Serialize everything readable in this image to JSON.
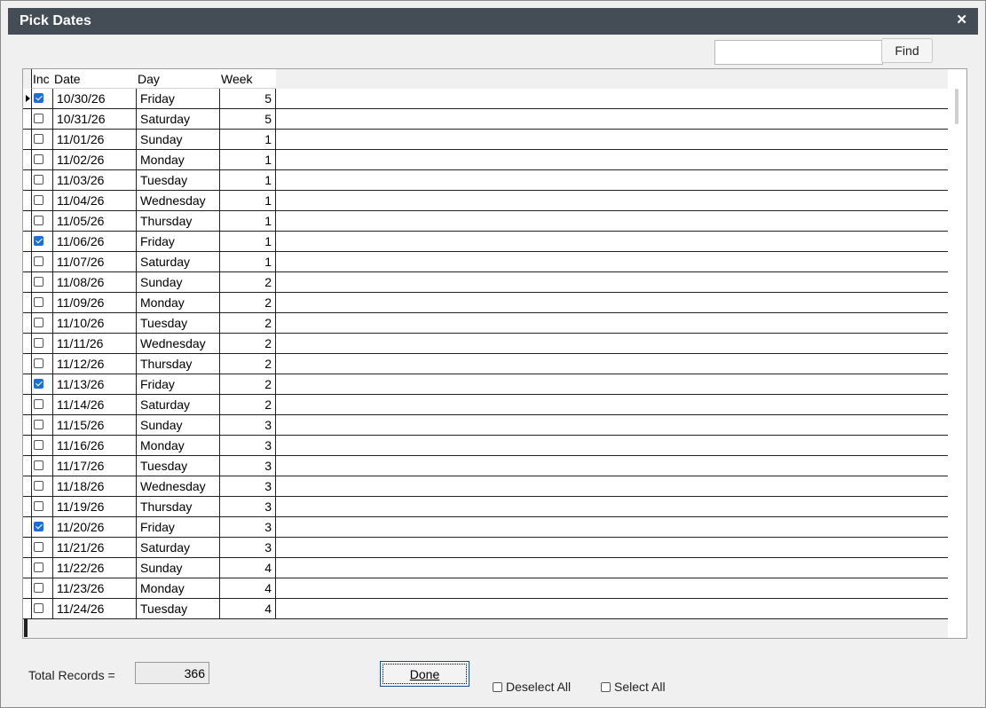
{
  "window": {
    "title": "Pick Dates",
    "close_glyph": "✕"
  },
  "search": {
    "value": "",
    "placeholder": "",
    "find_label": "Find"
  },
  "grid": {
    "columns": [
      "Inc",
      "Date",
      "Day",
      "Week"
    ],
    "rows": [
      {
        "inc": true,
        "date": "10/30/26",
        "day": "Friday",
        "week": "5",
        "current": true
      },
      {
        "inc": false,
        "date": "10/31/26",
        "day": "Saturday",
        "week": "5"
      },
      {
        "inc": false,
        "date": "11/01/26",
        "day": "Sunday",
        "week": "1"
      },
      {
        "inc": false,
        "date": "11/02/26",
        "day": "Monday",
        "week": "1"
      },
      {
        "inc": false,
        "date": "11/03/26",
        "day": "Tuesday",
        "week": "1"
      },
      {
        "inc": false,
        "date": "11/04/26",
        "day": "Wednesday",
        "week": "1"
      },
      {
        "inc": false,
        "date": "11/05/26",
        "day": "Thursday",
        "week": "1"
      },
      {
        "inc": true,
        "date": "11/06/26",
        "day": "Friday",
        "week": "1"
      },
      {
        "inc": false,
        "date": "11/07/26",
        "day": "Saturday",
        "week": "1"
      },
      {
        "inc": false,
        "date": "11/08/26",
        "day": "Sunday",
        "week": "2"
      },
      {
        "inc": false,
        "date": "11/09/26",
        "day": "Monday",
        "week": "2"
      },
      {
        "inc": false,
        "date": "11/10/26",
        "day": "Tuesday",
        "week": "2"
      },
      {
        "inc": false,
        "date": "11/11/26",
        "day": "Wednesday",
        "week": "2"
      },
      {
        "inc": false,
        "date": "11/12/26",
        "day": "Thursday",
        "week": "2"
      },
      {
        "inc": true,
        "date": "11/13/26",
        "day": "Friday",
        "week": "2"
      },
      {
        "inc": false,
        "date": "11/14/26",
        "day": "Saturday",
        "week": "2"
      },
      {
        "inc": false,
        "date": "11/15/26",
        "day": "Sunday",
        "week": "3"
      },
      {
        "inc": false,
        "date": "11/16/26",
        "day": "Monday",
        "week": "3"
      },
      {
        "inc": false,
        "date": "11/17/26",
        "day": "Tuesday",
        "week": "3"
      },
      {
        "inc": false,
        "date": "11/18/26",
        "day": "Wednesday",
        "week": "3"
      },
      {
        "inc": false,
        "date": "11/19/26",
        "day": "Thursday",
        "week": "3"
      },
      {
        "inc": true,
        "date": "11/20/26",
        "day": "Friday",
        "week": "3"
      },
      {
        "inc": false,
        "date": "11/21/26",
        "day": "Saturday",
        "week": "3"
      },
      {
        "inc": false,
        "date": "11/22/26",
        "day": "Sunday",
        "week": "4"
      },
      {
        "inc": false,
        "date": "11/23/26",
        "day": "Monday",
        "week": "4"
      },
      {
        "inc": false,
        "date": "11/24/26",
        "day": "Tuesday",
        "week": "4"
      }
    ]
  },
  "footer": {
    "total_label": "Total Records =",
    "total_value": "366",
    "done_label": "Done",
    "deselect_all_label": "Deselect All",
    "select_all_label": "Select All"
  },
  "colors": {
    "titlebar": "#444c55",
    "checked": "#1e6fd2"
  }
}
